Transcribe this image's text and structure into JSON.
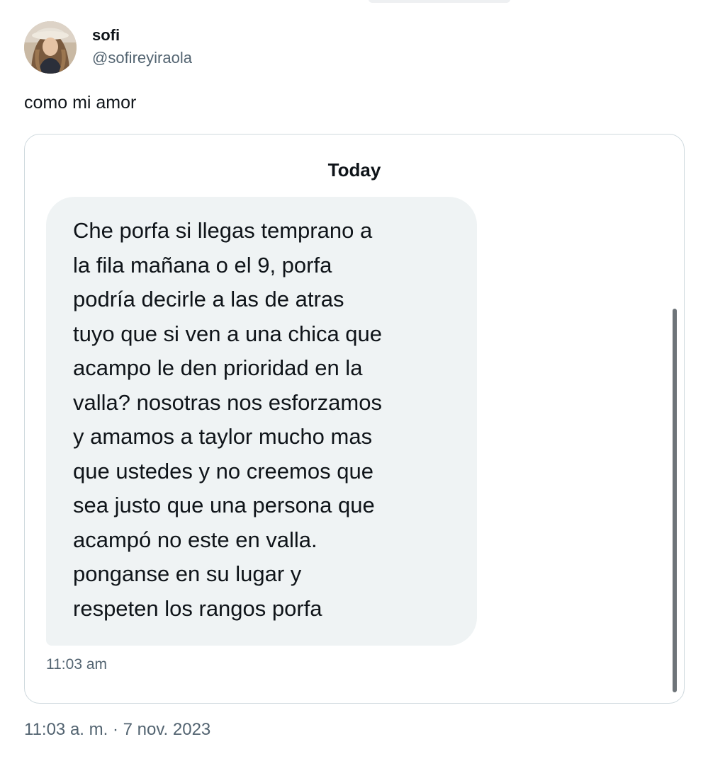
{
  "tweet": {
    "author": {
      "display_name": "sofi",
      "handle": "@sofireyiraola"
    },
    "text": "como mi amor",
    "timestamp": "11:03 a. m. · 7 nov. 2023"
  },
  "dm_screenshot": {
    "day_label": "Today",
    "message": {
      "text": "Che porfa si llegas temprano a\nla fila mañana o el 9, porfa\npodría decirle a las de atras\ntuyo que si ven a una chica que\nacampo le den prioridad en la\nvalla? nosotras nos esforzamos\ny amamos a taylor mucho mas\nque ustedes y no creemos que\nsea justo que una persona que\nacampó no este en valla.\nponganse en su lugar y\nrespeten los rangos porfa",
      "time": "11:03 am"
    }
  },
  "colors": {
    "bubble_background": "#eff3f4",
    "secondary_text": "#536471",
    "primary_text": "#0f1419",
    "card_border": "#cfd9de"
  }
}
